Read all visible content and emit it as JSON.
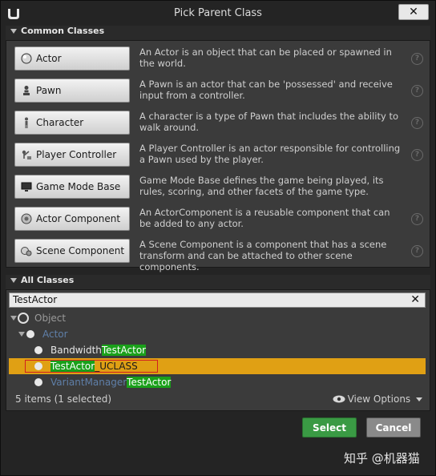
{
  "window": {
    "title": "Pick Parent Class",
    "close_label": "✕"
  },
  "common": {
    "header": "Common Classes",
    "classes": [
      {
        "label": "Actor",
        "icon": "sphere-icon",
        "description": "An Actor is an object that can be placed or spawned in the world."
      },
      {
        "label": "Pawn",
        "icon": "pawn-icon",
        "description": "A Pawn is an actor that can be 'possessed' and receive input from a controller."
      },
      {
        "label": "Character",
        "icon": "character-icon",
        "description": "A character is a type of Pawn that includes the ability to walk around."
      },
      {
        "label": "Player Controller",
        "icon": "controller-icon",
        "description": "A Player Controller is an actor responsible for controlling a Pawn used by the player."
      },
      {
        "label": "Game Mode Base",
        "icon": "monitor-icon",
        "description": "Game Mode Base defines the game being played, its rules, scoring, and other facets of the game type."
      },
      {
        "label": "Actor Component",
        "icon": "actor-component-icon",
        "description": "An ActorComponent is a reusable component that can be added to any actor."
      },
      {
        "label": "Scene Component",
        "icon": "scene-component-icon",
        "description": "A Scene Component is a component that has a scene transform and can be attached to other scene components."
      }
    ]
  },
  "all": {
    "header": "All Classes",
    "search_value": "TestActor",
    "tree": {
      "root": "Object",
      "actor": "Actor",
      "items": [
        {
          "prefix": "Bandwidth",
          "match": "TestActor",
          "suffix": ""
        },
        {
          "prefix": "",
          "match": "TestActor",
          "suffix": "_UCLASS"
        },
        {
          "prefix": "VariantManager",
          "match": "TestActor",
          "suffix": ""
        }
      ]
    },
    "status": "5 items (1 selected)",
    "view_options": "View Options"
  },
  "buttons": {
    "select": "Select",
    "cancel": "Cancel"
  },
  "watermark": "知乎 @机器猫",
  "colors": {
    "select": "#3a9a44",
    "selected_row": "#e0a014",
    "highlight": "#1aa01a"
  }
}
